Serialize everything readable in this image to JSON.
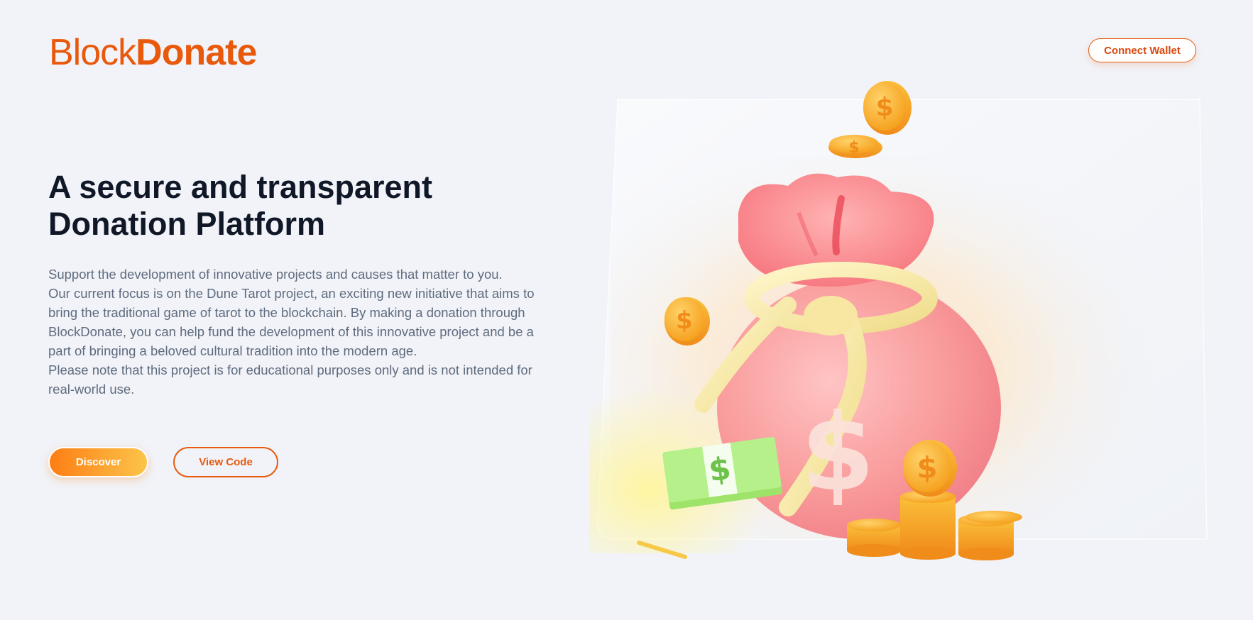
{
  "brand": {
    "logo_light": "Block",
    "logo_bold": "Donate",
    "color": "#e8590c"
  },
  "header": {
    "connect_wallet_label": "Connect Wallet"
  },
  "hero": {
    "title_line1": "A secure and transparent",
    "title_line2": "Donation Platform",
    "paragraphs": [
      "Support the development of innovative projects and causes that matter to you.",
      "Our current focus is on the Dune Tarot project, an exciting new initiative that aims to bring the traditional game of tarot to the blockchain. By making a donation through BlockDonate, you can help fund the development of this innovative project and be a part of bringing a beloved cultural tradition into the modern age.",
      "Please note that this project is for educational purposes only and is not intended for real-world use."
    ],
    "discover_label": "Discover",
    "view_code_label": "View Code"
  },
  "illustration": {
    "subject": "money-bag-icon",
    "coin_symbol": "$",
    "bill_symbol": "$",
    "colors": {
      "bag": "#f9a3a3",
      "rope": "#f6e9a8",
      "coin": "#f9b233",
      "bill": "#b6f08a",
      "accent": "#fd7e14"
    }
  }
}
